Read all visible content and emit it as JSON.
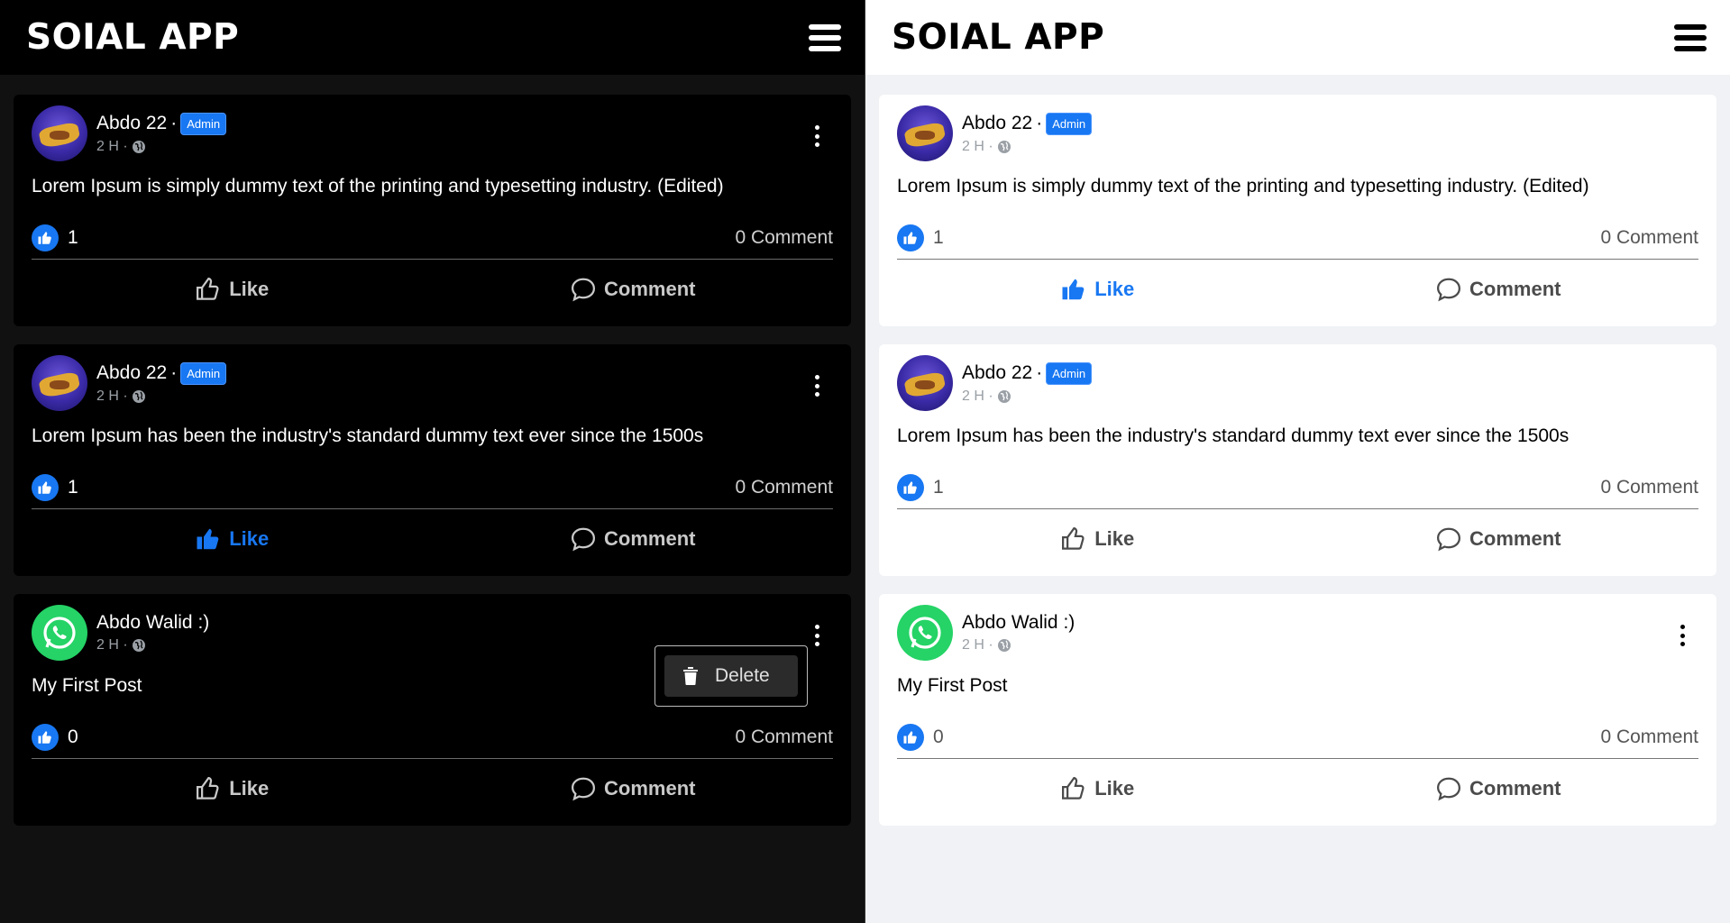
{
  "colors": {
    "accent": "#1877f2",
    "dark_bg": "#111111",
    "dark_card": "#000000",
    "light_bg": "#f0f2f5",
    "light_card": "#ffffff"
  },
  "header": {
    "title": "SOIAL APP",
    "menu_icon": "hamburger-icon"
  },
  "labels": {
    "like": "Like",
    "comment": "Comment",
    "delete": "Delete"
  },
  "posts": [
    {
      "author": "Abdo 22",
      "badge": "Admin",
      "time": "2 H",
      "text": "Lorem Ipsum is simply dummy text of the printing and typesetting industry. (Edited)",
      "likes": "1",
      "comments": "0 Comment",
      "avatar": "artwork-avatar"
    },
    {
      "author": "Abdo 22",
      "badge": "Admin",
      "time": "2 H",
      "text": "Lorem Ipsum has been the industry's standard dummy text ever since the 1500s",
      "likes": "1",
      "comments": "0 Comment",
      "avatar": "artwork-avatar"
    },
    {
      "author": "Abdo Walid :)",
      "badge": "",
      "time": "2 H",
      "text": "My First Post",
      "likes": "0",
      "comments": "0 Comment",
      "avatar": "whatsapp-avatar"
    }
  ],
  "dark_panel": {
    "liked_post_index": 1,
    "open_menu_post_index": 2
  },
  "light_panel": {
    "liked_post_index": 0
  }
}
